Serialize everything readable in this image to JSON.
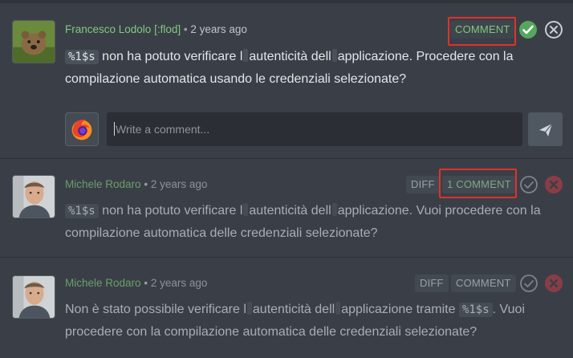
{
  "suggestions": [
    {
      "author": "Francesco Lodolo [:flod]",
      "time": "2 years ago",
      "comment_label": "COMMENT",
      "text": {
        "ph": "%1$s",
        "p1": " non ha potuto verificare l",
        "p2": "autenticità dell",
        "p3": "applicazione. Procedere con la compilazione automatica usando le credenziali selezionate?"
      }
    },
    {
      "author": "Michele Rodaro",
      "time": "2 years ago",
      "diff_label": "DIFF",
      "comment_label": "1 COMMENT",
      "text": {
        "ph": "%1$s",
        "p1": " non ha potuto verificare l",
        "p2": "autenticità dell",
        "p3": "applicazione. Vuoi procedere con la compilazione automatica delle credenziali selezionate?"
      }
    },
    {
      "author": "Michele Rodaro",
      "time": "2 years ago",
      "diff_label": "DIFF",
      "comment_label": "COMMENT",
      "text": {
        "p0": "Non è stato possibile verificare l",
        "p1": "autenticità dell",
        "p2": "applicazione tramite ",
        "ph": "%1$s",
        "p3": ". Vuoi procedere con la compilazione automatica delle credenziali selezionate?"
      }
    }
  ],
  "reply": {
    "placeholder": "Write a comment..."
  },
  "icons": {
    "approve": "check-circle-icon",
    "reject": "x-circle-icon",
    "send": "paper-plane-icon"
  },
  "colors": {
    "author_green": "#7fc97f",
    "approve_green": "#54a85d",
    "reject_red": "#c74250",
    "highlight_red": "#e0322a"
  }
}
